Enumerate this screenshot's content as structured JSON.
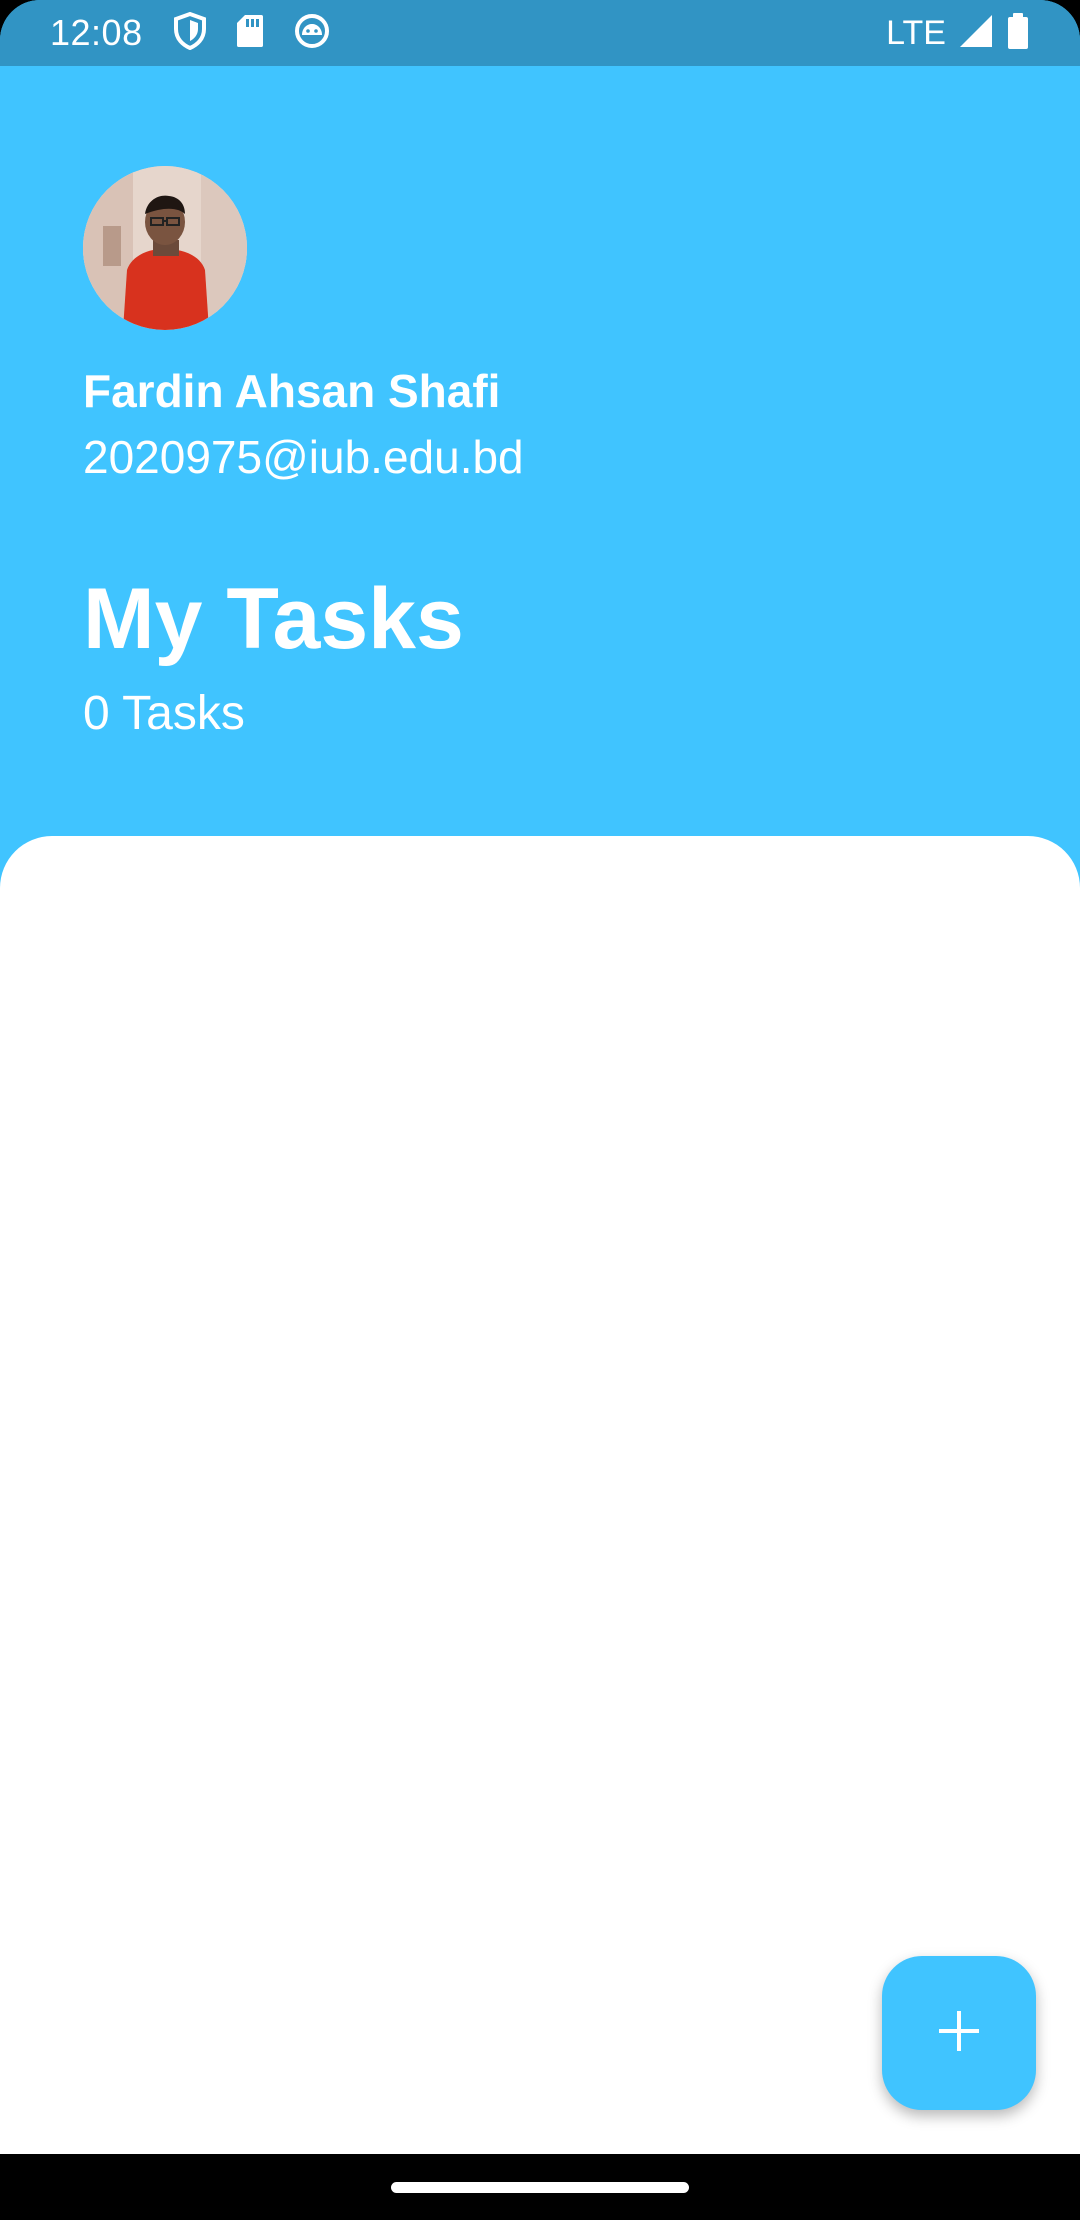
{
  "status_bar": {
    "time": "12:08",
    "network": "LTE",
    "icons": [
      "shield-icon",
      "sd-card-icon",
      "android-icon",
      "signal-icon",
      "battery-icon"
    ]
  },
  "profile": {
    "name": "Fardin Ahsan Shafi",
    "email": "2020975@iub.edu.bd"
  },
  "page": {
    "title": "My Tasks",
    "task_count_label": "0 Tasks"
  },
  "fab": {
    "icon": "plus-icon"
  },
  "colors": {
    "accent": "#40c4ff",
    "status_bar": "#3194c4",
    "panel": "#ffffff"
  }
}
